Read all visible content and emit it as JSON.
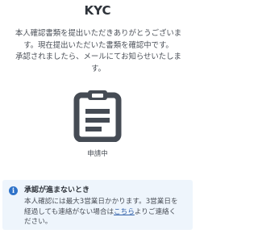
{
  "header": {
    "title": "KYC"
  },
  "message": {
    "line1": "本人確認書類を提出いただきありがとうございま",
    "line2": "す。現在提出いただいた書類を確認中です。",
    "line3": "承認されましたら、メールにてお知らせいたしま",
    "line4": "す。"
  },
  "status": {
    "icon": "clipboard-icon",
    "label": "申請中"
  },
  "notice": {
    "icon": "info-icon",
    "title": "承認が進まないとき",
    "body_line1": "本人確認には最大3営業日かかります。3営業日を",
    "body_line2_before": "経過しても連絡がない場合は",
    "link_label": "こちら",
    "body_line2_after": "よりご連絡く",
    "body_line3": "ださい。",
    "accent_color": "#2f73c9",
    "background_color": "#eef5fc"
  }
}
